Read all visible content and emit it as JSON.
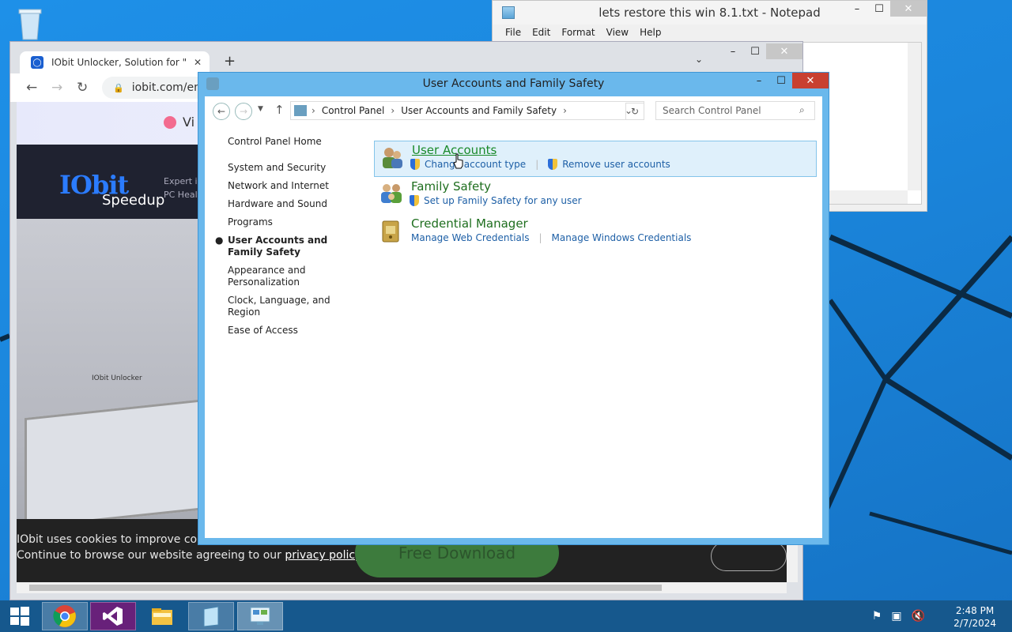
{
  "notepad": {
    "title": "lets restore this win 8.1.txt - Notepad",
    "menu": [
      "File",
      "Edit",
      "Format",
      "View",
      "Help"
    ],
    "controls": {
      "minimize": "–",
      "maximize": "☐",
      "close": "✕"
    }
  },
  "chrome": {
    "tab_title": "IObit Unlocker, Solution for \"und",
    "tab_close": "✕",
    "new_tab": "+",
    "dropdown": "⌄",
    "url": "iobit.com/en/io",
    "banner_text": "Vi",
    "site": {
      "logo": "IObit",
      "logo_sub": "Speedup",
      "tagline_1": "Expert in",
      "tagline_2": "PC Health"
    },
    "laptop_label": "IObit Unlocker",
    "cookie_text_1": "IObit uses cookies to improve content",
    "cookie_text_2": "Continue to browse our website agreeing to our",
    "cookie_link": "privacy policy",
    "cookie_period": ".",
    "free_download": "Free Download"
  },
  "control_panel": {
    "title": "User Accounts and Family Safety",
    "breadcrumb": [
      "Control Panel",
      "User Accounts and Family Safety"
    ],
    "search_placeholder": "Search Control Panel",
    "left_nav": {
      "home": "Control Panel Home",
      "items": [
        "System and Security",
        "Network and Internet",
        "Hardware and Sound",
        "Programs"
      ],
      "active": "User Accounts and Family Safety",
      "items_after": [
        "Appearance and Personalization",
        "Clock, Language, and Region",
        "Ease of Access"
      ]
    },
    "categories": [
      {
        "title": "User Accounts",
        "links": [
          "Change account type",
          "Remove user accounts"
        ]
      },
      {
        "title": "Family Safety",
        "links": [
          "Set up Family Safety for any user"
        ]
      },
      {
        "title": "Credential Manager",
        "links": [
          "Manage Web Credentials",
          "Manage Windows Credentials"
        ]
      }
    ]
  },
  "taskbar": {
    "clock_time": "2:48 PM",
    "clock_date": "2/7/2024"
  }
}
